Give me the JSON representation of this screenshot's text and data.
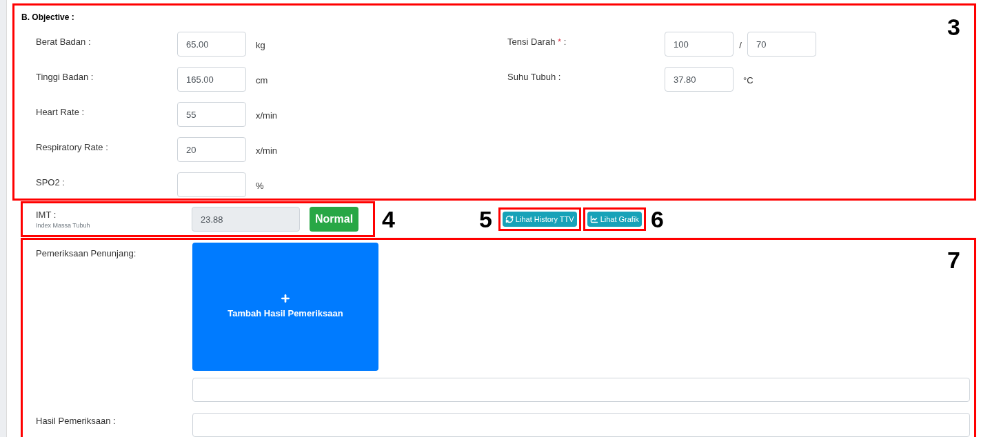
{
  "section_title": "B. Objective :",
  "left_fields": [
    {
      "label": "Berat Badan :",
      "value": "65.00",
      "unit": "kg"
    },
    {
      "label": "Tinggi Badan :",
      "value": "165.00",
      "unit": "cm"
    },
    {
      "label": "Heart Rate :",
      "value": "55",
      "unit": "x/min"
    },
    {
      "label": "Respiratory Rate :",
      "value": "20",
      "unit": "x/min"
    },
    {
      "label": "SPO2 :",
      "unit": "%"
    }
  ],
  "right_fields": [
    {
      "kind": "pair",
      "label": "Tensi Darah",
      "required_mark": "*",
      "colon": ":",
      "values": [
        "100",
        "70"
      ],
      "separator": "/"
    },
    {
      "kind": "single",
      "label": "Suhu Tubuh :",
      "value": "37.80",
      "unit": "°C"
    }
  ],
  "imt": {
    "label": "IMT :",
    "sublabel": "Index Massa Tubuh",
    "value": "23.88",
    "status": "Normal"
  },
  "buttons": [
    {
      "kind": "history",
      "label": "Lihat History TTV"
    },
    {
      "kind": "chart",
      "label": "Lihat Grafik"
    }
  ],
  "pemeriksaan": {
    "label": "Pemeriksaan Penunjang:",
    "add_button": "Tambah Hasil Pemeriksaan",
    "result_label": "Hasil Pemeriksaan :"
  },
  "annotations": [
    "3",
    "4",
    "5",
    "6",
    "7"
  ]
}
